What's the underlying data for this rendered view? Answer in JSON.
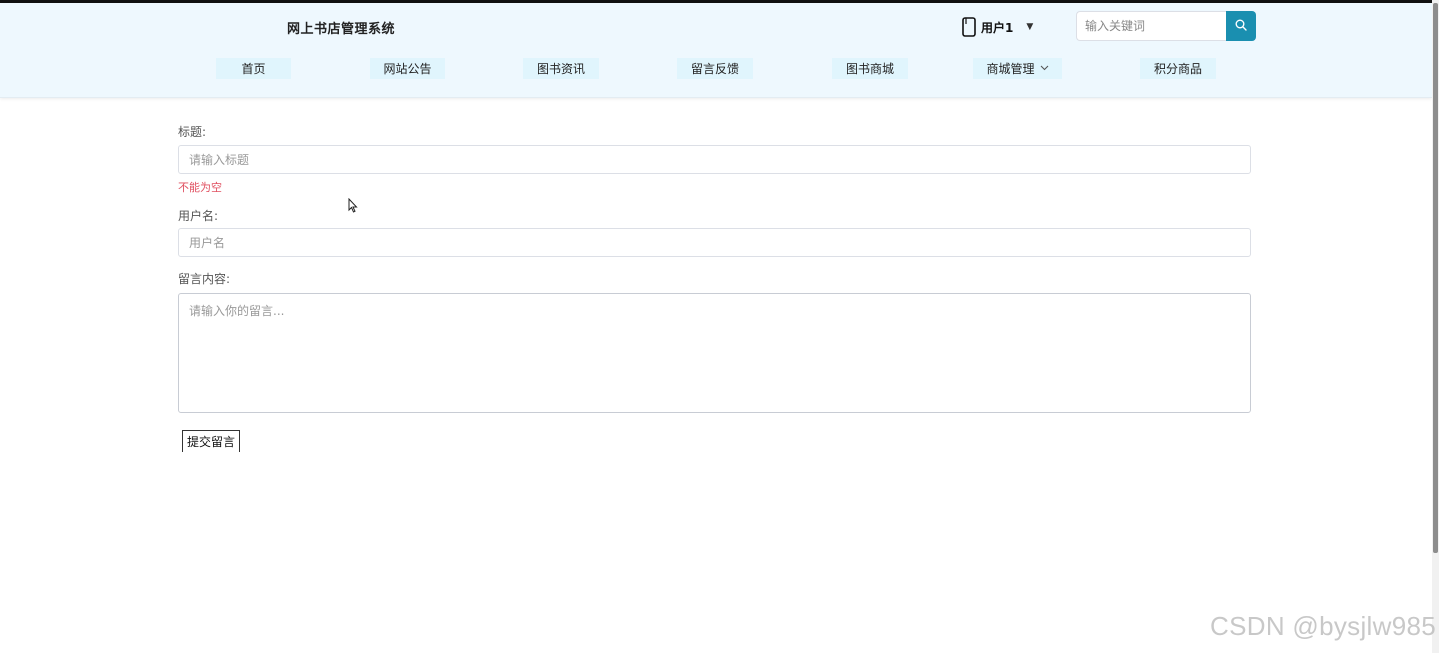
{
  "header": {
    "site_title": "网上书店管理系统",
    "user_name": "用户1",
    "search_placeholder": "输入关键词"
  },
  "nav": {
    "items": [
      {
        "label": "首页"
      },
      {
        "label": "网站公告"
      },
      {
        "label": "图书资讯"
      },
      {
        "label": "留言反馈"
      },
      {
        "label": "图书商城"
      },
      {
        "label": "商城管理",
        "has_dropdown": true
      },
      {
        "label": "积分商品"
      }
    ]
  },
  "form": {
    "title_label": "标题:",
    "title_placeholder": "请输入标题",
    "title_error": "不能为空",
    "username_label": "用户名:",
    "username_placeholder": "用户名",
    "content_label": "留言内容:",
    "content_placeholder": "请输入你的留言...",
    "submit_label": "提交留言"
  },
  "watermark": "CSDN @bysjlw985",
  "colors": {
    "header_bg": "#eef8fe",
    "nav_item_bg": "#e0f5fd",
    "search_button": "#1a8fb0",
    "error": "#e05060"
  },
  "icons": {
    "user": "user-icon",
    "user_caret": "caret-down-icon",
    "search": "search-icon",
    "nav_dropdown": "chevron-down-icon"
  }
}
